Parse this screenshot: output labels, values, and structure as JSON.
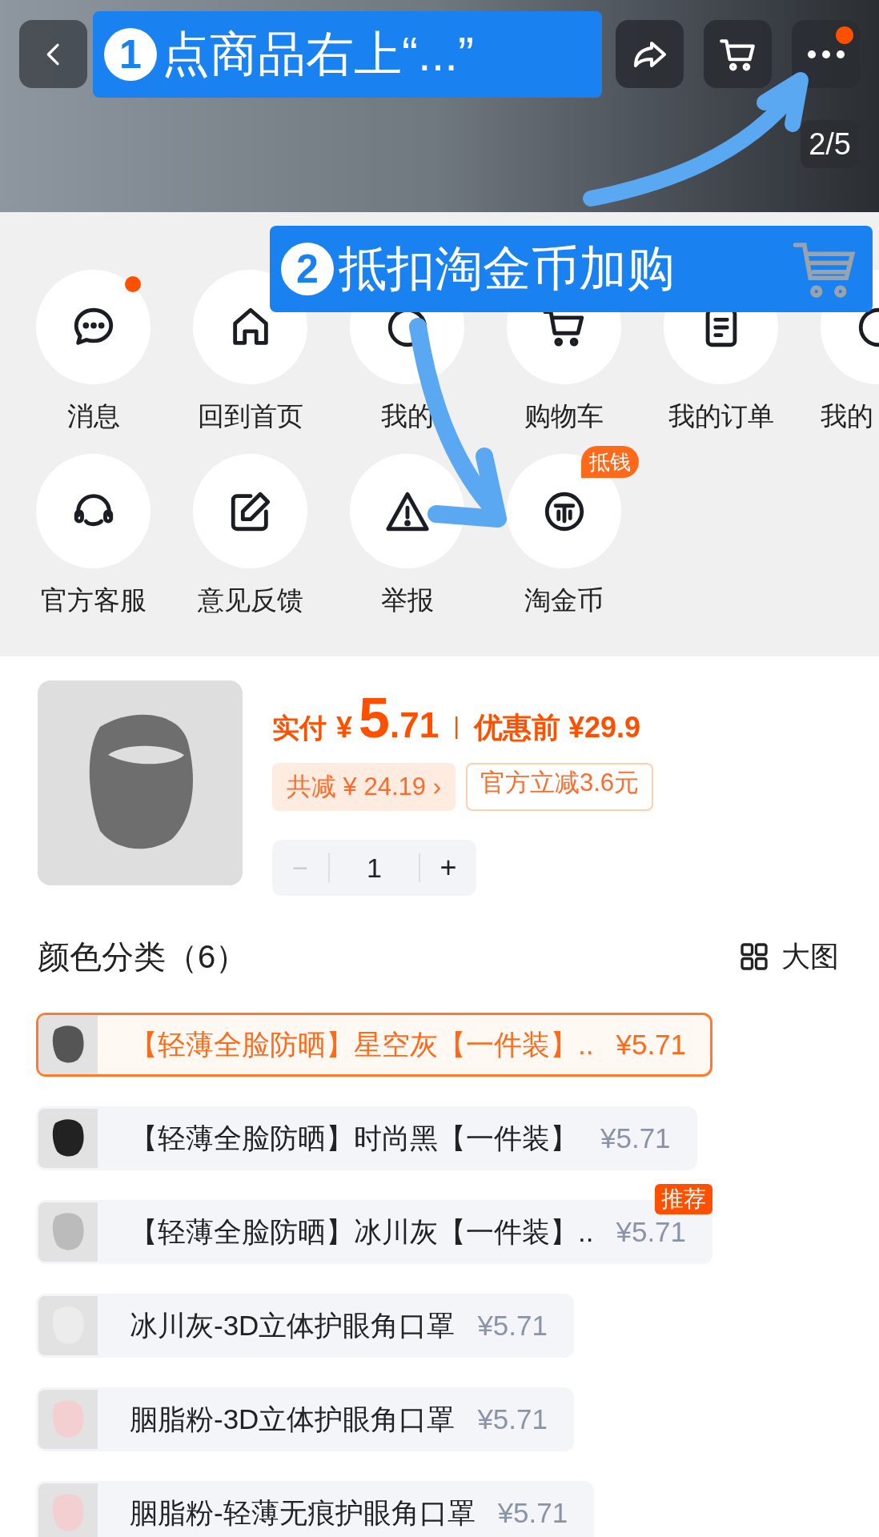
{
  "header": {
    "page_indicator": "2/5",
    "more_has_dot": true
  },
  "annotations": [
    {
      "number": "1",
      "text": "点商品右上“...”"
    },
    {
      "number": "2",
      "text": "抵扣淘金币加购"
    }
  ],
  "menu_rows": [
    [
      {
        "label": "消息",
        "dot": true
      },
      {
        "label": "回到首页"
      },
      {
        "label": "我的"
      },
      {
        "label": "购物车"
      },
      {
        "label": "我的订单"
      },
      {
        "label": "我的"
      }
    ],
    [
      {
        "label": "官方客服"
      },
      {
        "label": "意见反馈"
      },
      {
        "label": "举报"
      },
      {
        "label": "淘金币",
        "badge": "抵钱"
      }
    ]
  ],
  "product": {
    "pay_label": "实付",
    "currency": "¥",
    "price_int": "5",
    "price_dec": ".71",
    "separator": "|",
    "original_price": "优惠前 ¥29.9",
    "chips": [
      {
        "kind": "filled",
        "text": "共减 ¥ 24.19 ›"
      },
      {
        "kind": "outlined",
        "text": "官方立减3.6元"
      }
    ],
    "stepper": {
      "minus": "−",
      "value": "1",
      "plus": "+",
      "minus_disabled": true
    }
  },
  "variants": {
    "title": "颜色分类（6）",
    "view_toggle": "大图",
    "items": [
      {
        "name": "【轻薄全脸防晒】星空灰【一件装】..",
        "price": "¥5.71",
        "selected": true
      },
      {
        "name": "【轻薄全脸防晒】时尚黑【一件装】",
        "price": "¥5.71",
        "selected": false
      },
      {
        "name": "【轻薄全脸防晒】冰川灰【一件装】..",
        "price": "¥5.71",
        "selected": false,
        "badge": "推荐"
      },
      {
        "name": "冰川灰-3D立体护眼角口罩",
        "price": "¥5.71",
        "selected": false
      },
      {
        "name": "胭脂粉-3D立体护眼角口罩",
        "price": "¥5.71",
        "selected": false
      },
      {
        "name": "胭脂粉-轻薄无痕护眼角口罩",
        "price": "¥5.71",
        "selected": false
      }
    ]
  }
}
